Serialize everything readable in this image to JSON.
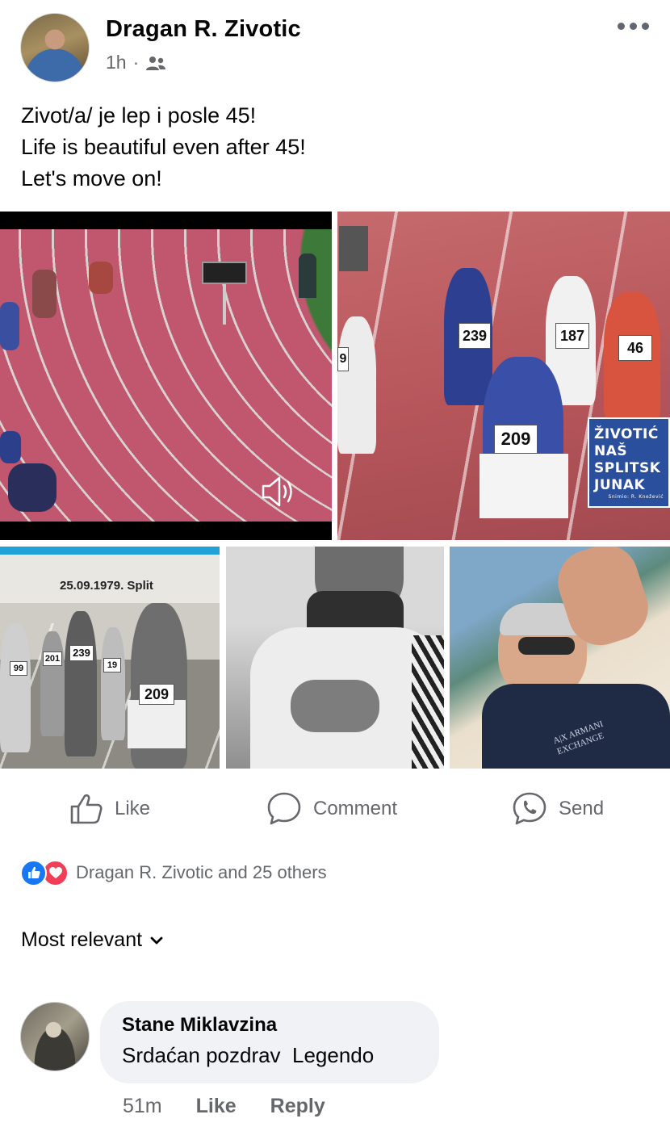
{
  "post": {
    "author": "Dragan R. Zivotic",
    "time": "1h",
    "separator": "·",
    "audience_icon": "friends-icon",
    "text_lines": [
      "Zivot/a/ je lep i posle 45!",
      "Life is beautiful even after 45!",
      "Let's move on!"
    ]
  },
  "media": {
    "track_photo": {
      "bibs": [
        "239",
        "187",
        "46",
        "209",
        "9"
      ],
      "headline": [
        "ŽIVOTIĆ",
        "NAŠ",
        "SPLITSK",
        "JUNAK"
      ],
      "credit": "Snimio: R. Knežević"
    },
    "bw_photo": {
      "caption": "25.09.1979. Split",
      "bibs": [
        "209",
        "239",
        "201",
        "99",
        "19"
      ]
    },
    "selfie_shirt": "A|X ARMANI EXCHANGE"
  },
  "actions": {
    "like": "Like",
    "comment": "Comment",
    "send": "Send"
  },
  "reactions": {
    "summary": "Dragan R. Zivotic and 25 others"
  },
  "comments": {
    "sort_label": "Most relevant",
    "items": [
      {
        "name": "Stane Miklavzina",
        "text": "Srdaćan pozdrav  Legendo",
        "time": "51m",
        "like": "Like",
        "reply": "Reply"
      }
    ]
  },
  "colors": {
    "primary_text": "#050505",
    "secondary_text": "#65676b",
    "like_blue": "#1877f2",
    "love_red": "#f33e58",
    "bubble_bg": "#f0f2f5"
  }
}
